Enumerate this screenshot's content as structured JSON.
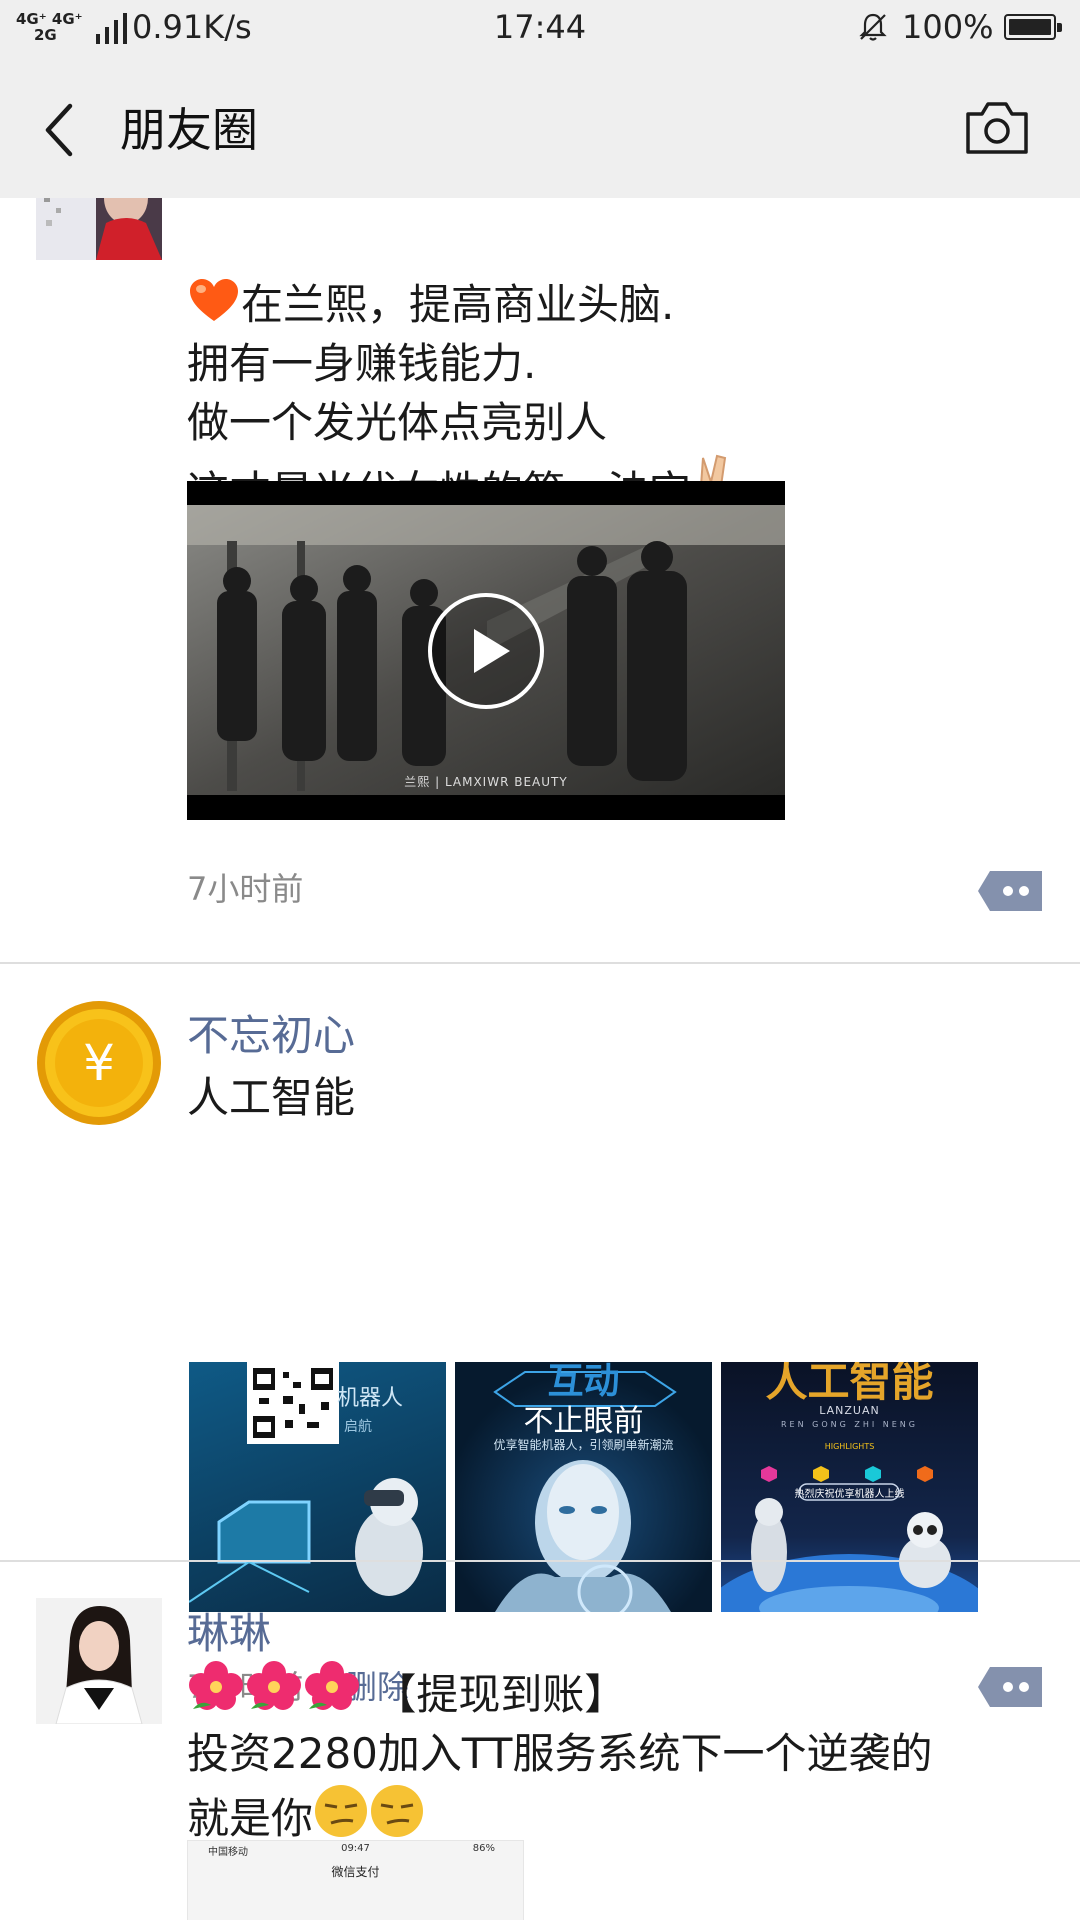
{
  "status_bar": {
    "network_top": "4G⁺ 4G⁺",
    "network_bottom": "2G",
    "speed": "0.91K/s",
    "time": "17:44",
    "battery": "100%"
  },
  "nav": {
    "title": "朋友圈"
  },
  "posts": [
    {
      "text": "在兰熙，提高商业头脑.\n拥有一身赚钱能力.\n做一个发光体点亮别人\n这才是当代女性的第一法宝",
      "video_caption": "兰熙 | LAMXIWR BEAUTY",
      "time": "7小时前"
    },
    {
      "name": "不忘初心",
      "text": "人工智能",
      "images": [
        {
          "caption_1": "机器人",
          "caption_2": "启航"
        },
        {
          "caption_1": "互动",
          "caption_2": "不止眼前",
          "caption_3": "优享智能机器人，引领刷单新潮流"
        },
        {
          "caption_1": "人工智能",
          "caption_2": "LANZUAN",
          "caption_3": "REN GONG ZHI NENG",
          "caption_4": "HIGHLIGHTS",
          "caption_5": "热烈庆祝优享机器人上线"
        }
      ],
      "time": "7小时前",
      "delete_label": "删除"
    },
    {
      "name": "琳琳",
      "text_line1": "【提现到账】",
      "text_line2": "投资2280加入TT服务系统下一个逆袭的",
      "text_line3": "就是你",
      "preview_carrier": "中国移动",
      "preview_time": "09:47",
      "preview_battery": "86%",
      "preview_title": "微信支付"
    }
  ],
  "colors": {
    "link_blue": "#576b95",
    "bar_gray": "#efefef",
    "action_button": "#8491ad"
  }
}
